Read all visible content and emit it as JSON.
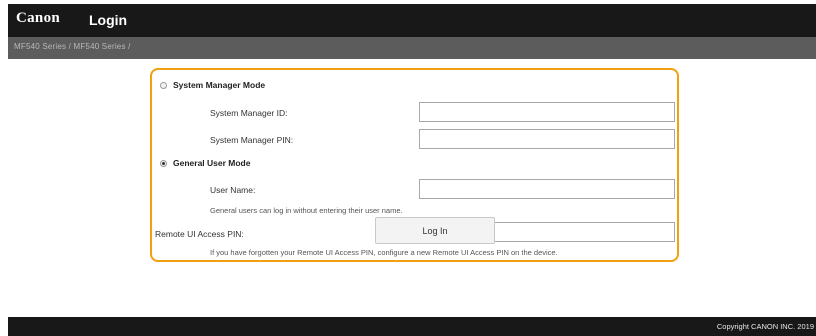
{
  "header": {
    "brand": "Canon",
    "title": "Login"
  },
  "subbar": {
    "breadcrumb": "MF540 Series / MF540 Series /"
  },
  "login": {
    "system_manager_mode": {
      "label": "System Manager Mode",
      "selected": false,
      "id_label": "System Manager ID:",
      "id_value": "",
      "pin_label": "System Manager PIN:",
      "pin_value": ""
    },
    "general_user_mode": {
      "label": "General User Mode",
      "selected": true,
      "user_name_label": "User Name:",
      "user_name_value": "",
      "hint": "General users can log in without entering their user name."
    },
    "remote_ui_pin": {
      "label": "Remote UI Access PIN:",
      "value": "",
      "hint": "If you have forgotten your Remote UI Access PIN, configure a new Remote UI Access PIN on the device."
    },
    "login_button": "Log In"
  },
  "footer": {
    "copyright": "Copyright CANON INC. 2019"
  },
  "colors": {
    "header_bg": "#181818",
    "subbar_bg": "#5c5c5c",
    "highlight_border": "#f0a011"
  }
}
